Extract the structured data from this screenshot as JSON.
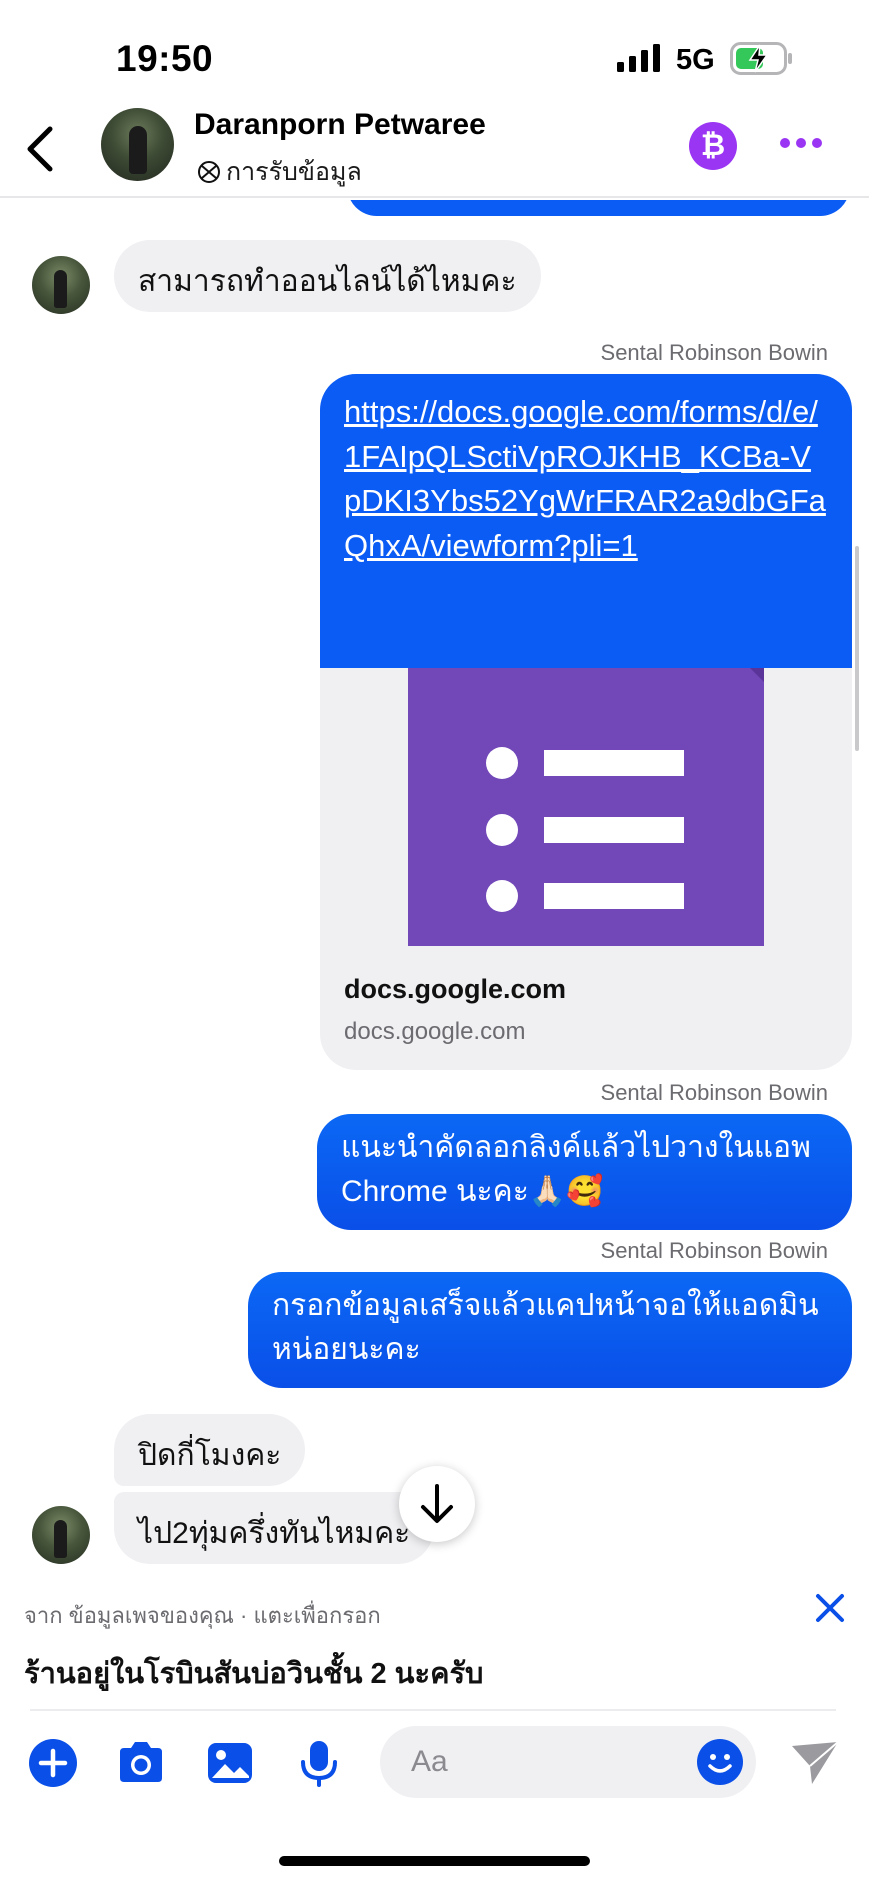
{
  "status_bar": {
    "time": "19:50",
    "network": "5G",
    "icons": [
      "signal-icon",
      "battery-charging-icon"
    ]
  },
  "header": {
    "contact_name": "Daranporn Petwaree",
    "subtitle": "การรับข้อมูล",
    "icons": [
      "back-chevron-icon",
      "avatar",
      "ai-knot-icon",
      "bitcoin-icon",
      "more-dots-icon"
    ]
  },
  "messages": [
    {
      "direction": "in",
      "text": "สามารถทำออนไลน์ได้ไหมคะ"
    },
    {
      "direction": "out",
      "sender": "Sental Robinson Bowin",
      "type": "link",
      "text": "https://docs.google.com/forms/d/e/1FAIpQLSctiVpROJKHB_KCBa-VpDKI3Ybs52YgWrFRAR2a9dbGFaQhxA/viewform?pli=1",
      "preview_title": "docs.google.com",
      "preview_domain": "docs.google.com"
    },
    {
      "direction": "out",
      "sender": "Sental Robinson Bowin",
      "text": "แนะนำคัดลอกลิงค์แล้วไปวางในแอพ Chrome นะคะ🙏🏻🥰"
    },
    {
      "direction": "out",
      "sender": "Sental Robinson Bowin",
      "text": "กรอกข้อมูลเสร็จแล้วแคปหน้าจอให้แอดมินหน่อยนะคะ"
    },
    {
      "direction": "in",
      "text": "ปิดกี่โมงคะ"
    },
    {
      "direction": "in",
      "text": "ไป2ทุ่มครึ่งทันไหมคะ"
    }
  ],
  "suggestion": {
    "meta": "จาก ข้อมูลเพจของคุณ · แตะเพื่อกรอก",
    "text": "ร้านอยู่ในโรบินสันบ่อวินชั้น 2 นะครับ"
  },
  "composer": {
    "placeholder": "Aa",
    "icons": [
      "plus-icon",
      "camera-icon",
      "image-icon",
      "microphone-icon",
      "emoji-icon",
      "send-icon"
    ]
  },
  "colors": {
    "brand_blue": "#0a5cf5",
    "incoming_bubble": "#f0f0f3",
    "bitcoin_purple": "#9a35f3",
    "forms_purple": "#7248b9"
  }
}
